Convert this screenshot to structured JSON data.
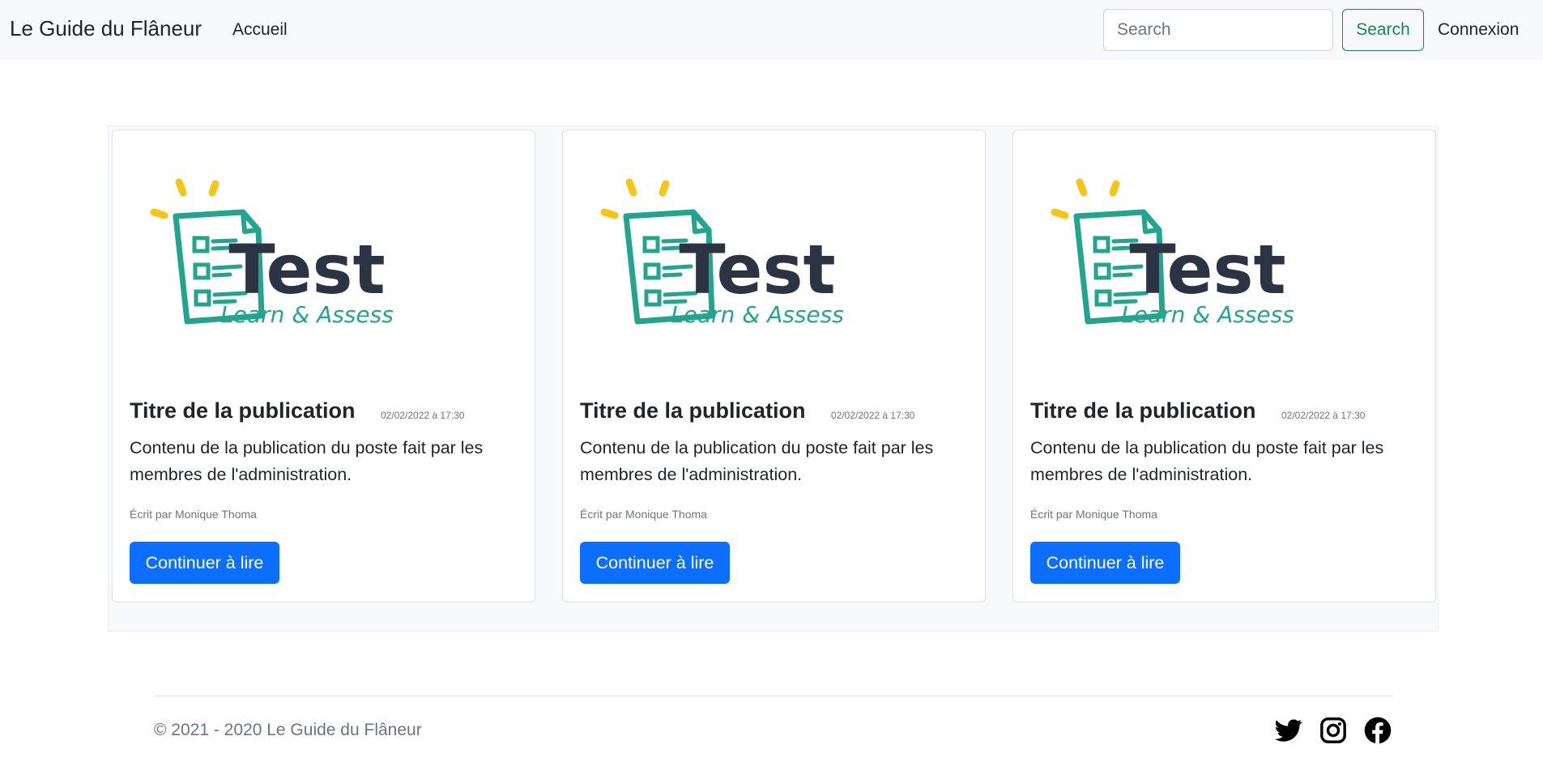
{
  "navbar": {
    "brand": "Le Guide du Flâneur",
    "home_link": "Accueil",
    "search_placeholder": "Search",
    "search_button": "Search",
    "login_link": "Connexion"
  },
  "cards": [
    {
      "image": {
        "title": "Test",
        "subtitle": "Learn & Assess"
      },
      "title": "Titre de la publication",
      "date": "02/02/2022 à 17:30",
      "text": "Contenu de la publication du poste fait par les membres de l'administration.",
      "author": "Écrit par Monique Thoma",
      "button": "Continuer à lire"
    },
    {
      "image": {
        "title": "Test",
        "subtitle": "Learn & Assess"
      },
      "title": "Titre de la publication",
      "date": "02/02/2022 à 17:30",
      "text": "Contenu de la publication du poste fait par les membres de l'administration.",
      "author": "Écrit par Monique Thoma",
      "button": "Continuer à lire"
    },
    {
      "image": {
        "title": "Test",
        "subtitle": "Learn & Assess"
      },
      "title": "Titre de la publication",
      "date": "02/02/2022 à 17:30",
      "text": "Contenu de la publication du poste fait par les membres de l'administration.",
      "author": "Écrit par Monique Thoma",
      "button": "Continuer à lire"
    }
  ],
  "footer": {
    "copyright": "© 2021 - 2020 Le Guide du Flâneur",
    "social_icons": [
      "twitter-icon",
      "instagram-icon",
      "facebook-icon"
    ]
  },
  "colors": {
    "navbar_bg": "#f8f9fa",
    "primary": "#0d6efd",
    "success": "#198754",
    "logo_teal": "#23a48c",
    "logo_yellow": "#f5c518",
    "logo_dark": "#2c3443",
    "muted": "#6c757d"
  }
}
